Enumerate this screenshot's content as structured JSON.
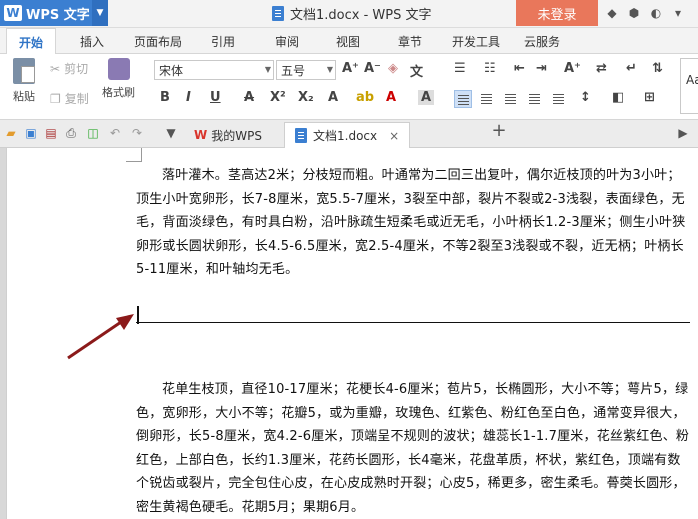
{
  "titlebar": {
    "app_name": "WPS 文字",
    "logo": "W",
    "doc_title": "文档1.docx - WPS 文字",
    "login": "未登录"
  },
  "ribbon_tabs": [
    "开始",
    "插入",
    "页面布局",
    "引用",
    "审阅",
    "视图",
    "章节",
    "开发工具",
    "云服务"
  ],
  "ribbon": {
    "paste": "粘贴",
    "cut": "剪切",
    "copy": "复制",
    "format_painter": "格式刷",
    "font_name": "宋体",
    "font_size": "五号",
    "style_preview": "Aa"
  },
  "doc_tabs": {
    "tab1": "我的WPS",
    "tab2": "文档1.docx",
    "new_tab": "+"
  },
  "document": {
    "para1": "落叶灌木。茎高达2米；分枝短而粗。叶通常为二回三出复叶，偶尔近枝顶的叶为3小叶；顶生小叶宽卵形，长7-8厘米，宽5.5-7厘米，3裂至中部，裂片不裂或2-3浅裂，表面绿色，无毛，背面淡绿色，有时具白粉，沿叶脉疏生短柔毛或近无毛，小叶柄长1.2-3厘米；侧生小叶狭卵形或长圆状卵形，长4.5-6.5厘米，宽2.5-4厘米，不等2裂至3浅裂或不裂，近无柄；叶柄长5-11厘米，和叶轴均无毛。",
    "para2": "花单生枝顶，直径10-17厘米；花梗长4-6厘米；苞片5，长椭圆形，大小不等；萼片5，绿色，宽卵形，大小不等；花瓣5，或为重瓣，玫瑰色、红紫色、粉红色至白色，通常变异很大，倒卵形，长5-8厘米，宽4.2-6厘米，顶端呈不规则的波状；雄蕊长1-1.7厘米，花丝紫红色、粉红色，上部白色，长约1.3厘米，花药长圆形，长4毫米，花盘革质，杯状，紫红色，顶端有数个锐齿或裂片，完全包住心皮，在心皮成熟时开裂；心皮5，稀更多，密生柔毛。蓇葖长圆形，密生黄褐色硬毛。花期5月；果期6月。"
  },
  "colors": {
    "app_blue": "#3b7fd1",
    "login_orange": "#e9775b",
    "arrow_red": "#8b1a1a"
  }
}
